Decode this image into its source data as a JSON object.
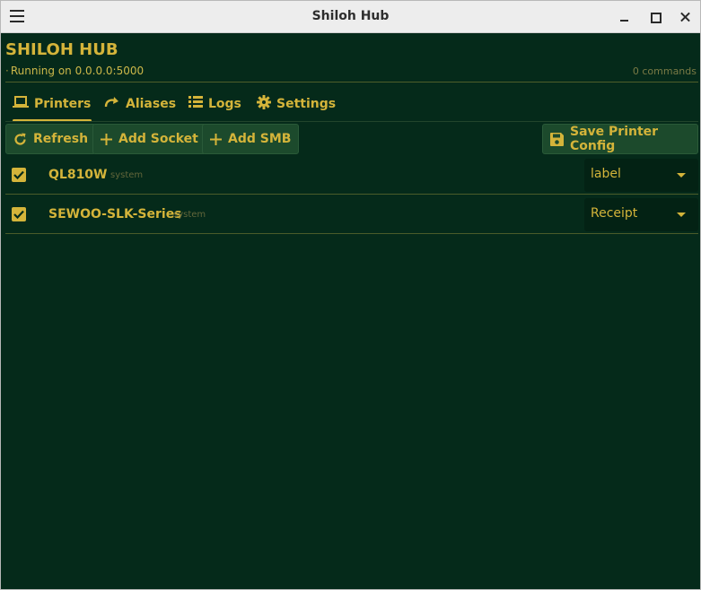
{
  "window": {
    "title": "Shiloh Hub"
  },
  "app": {
    "title": "SHILOH HUB",
    "status": "Running on 0.0.0.0:5000",
    "commands": "0 commands"
  },
  "tabs": [
    {
      "label": "Printers",
      "icon": "laptop-icon",
      "active": true
    },
    {
      "label": "Aliases",
      "icon": "redo-arrow-icon",
      "active": false
    },
    {
      "label": "Logs",
      "icon": "list-icon",
      "active": false
    },
    {
      "label": "Settings",
      "icon": "gear-icon",
      "active": false
    }
  ],
  "toolbar": {
    "refresh": "Refresh",
    "add_socket": "Add Socket",
    "add_smb": "Add SMB",
    "save": "Save Printer Config"
  },
  "printers": [
    {
      "name": "QL810W",
      "tag": "system",
      "enabled": true,
      "type": "label"
    },
    {
      "name": "SEWOO-SLK-Series",
      "tag": "system",
      "enabled": true,
      "type": "Receipt"
    }
  ],
  "colors": {
    "background": "#052a1a",
    "accent": "#d4b43a",
    "button": "#1c4a2c",
    "titlebar": "#ededed"
  }
}
